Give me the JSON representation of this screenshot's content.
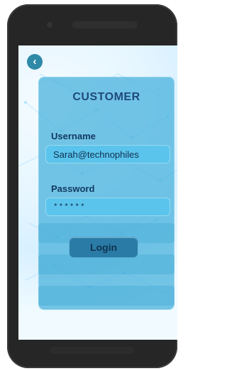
{
  "header": {
    "back_icon": "chevron-left-icon",
    "back_glyph": "‹"
  },
  "form": {
    "title": "CUSTOMER",
    "username_label": "Username",
    "username_value": "Sarah@technophiles",
    "password_label": "Password",
    "password_value": "******",
    "login_label": "Login"
  },
  "colors": {
    "accent": "#2f8aa8",
    "card_bg": "#48b2dc",
    "title_text": "#1e4a7b",
    "button_bg": "#2a7ca7"
  }
}
